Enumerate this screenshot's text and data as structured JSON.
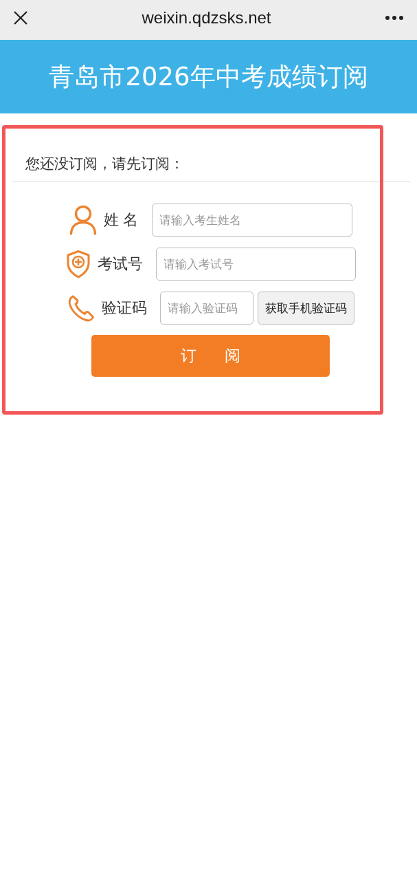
{
  "top_bar": {
    "url": "weixin.qdzsks.net"
  },
  "header": {
    "title": "青岛市2026年中考成绩订阅"
  },
  "form": {
    "prompt": "您还没订阅，请先订阅：",
    "fields": [
      {
        "kind": "name",
        "label": "姓 名",
        "placeholder": "请输入考生姓名"
      },
      {
        "kind": "exam",
        "label": "考试号",
        "placeholder": "请输入考试号"
      },
      {
        "kind": "code",
        "label": "验证码",
        "placeholder": "请输入验证码",
        "button": "获取手机验证码"
      }
    ],
    "submit": "订 阅"
  }
}
